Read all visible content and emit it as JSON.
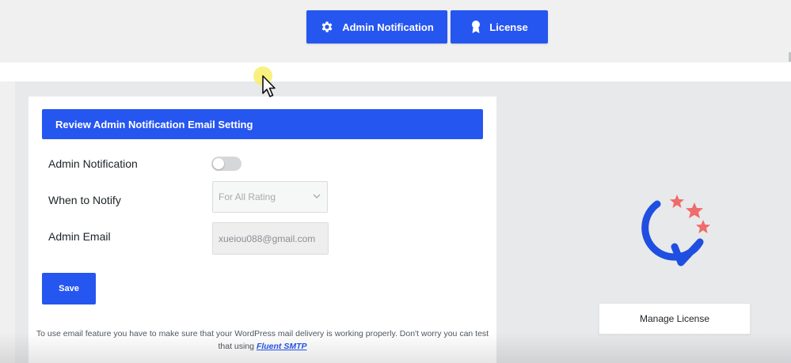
{
  "tabs": [
    {
      "label": "Admin Notification",
      "icon": "gear-icon"
    },
    {
      "label": "License",
      "icon": "award-icon"
    }
  ],
  "panel": {
    "header": "Review Admin Notification Email Setting",
    "rows": {
      "notification_label": "Admin Notification",
      "notification_enabled": false,
      "notify_label": "When to Notify",
      "notify_value": "For All Rating",
      "email_label": "Admin Email",
      "email_value": "xueiou088@gmail.com"
    },
    "save_label": "Save",
    "note_text": "To use email feature you have to make sure that your WordPress mail delivery is working properly. Don't worry you can test that using",
    "note_link": "Fluent SMTP"
  },
  "license": {
    "manage_label": "Manage License"
  },
  "colors": {
    "accent": "#2656f0",
    "star": "#f06b6b"
  }
}
